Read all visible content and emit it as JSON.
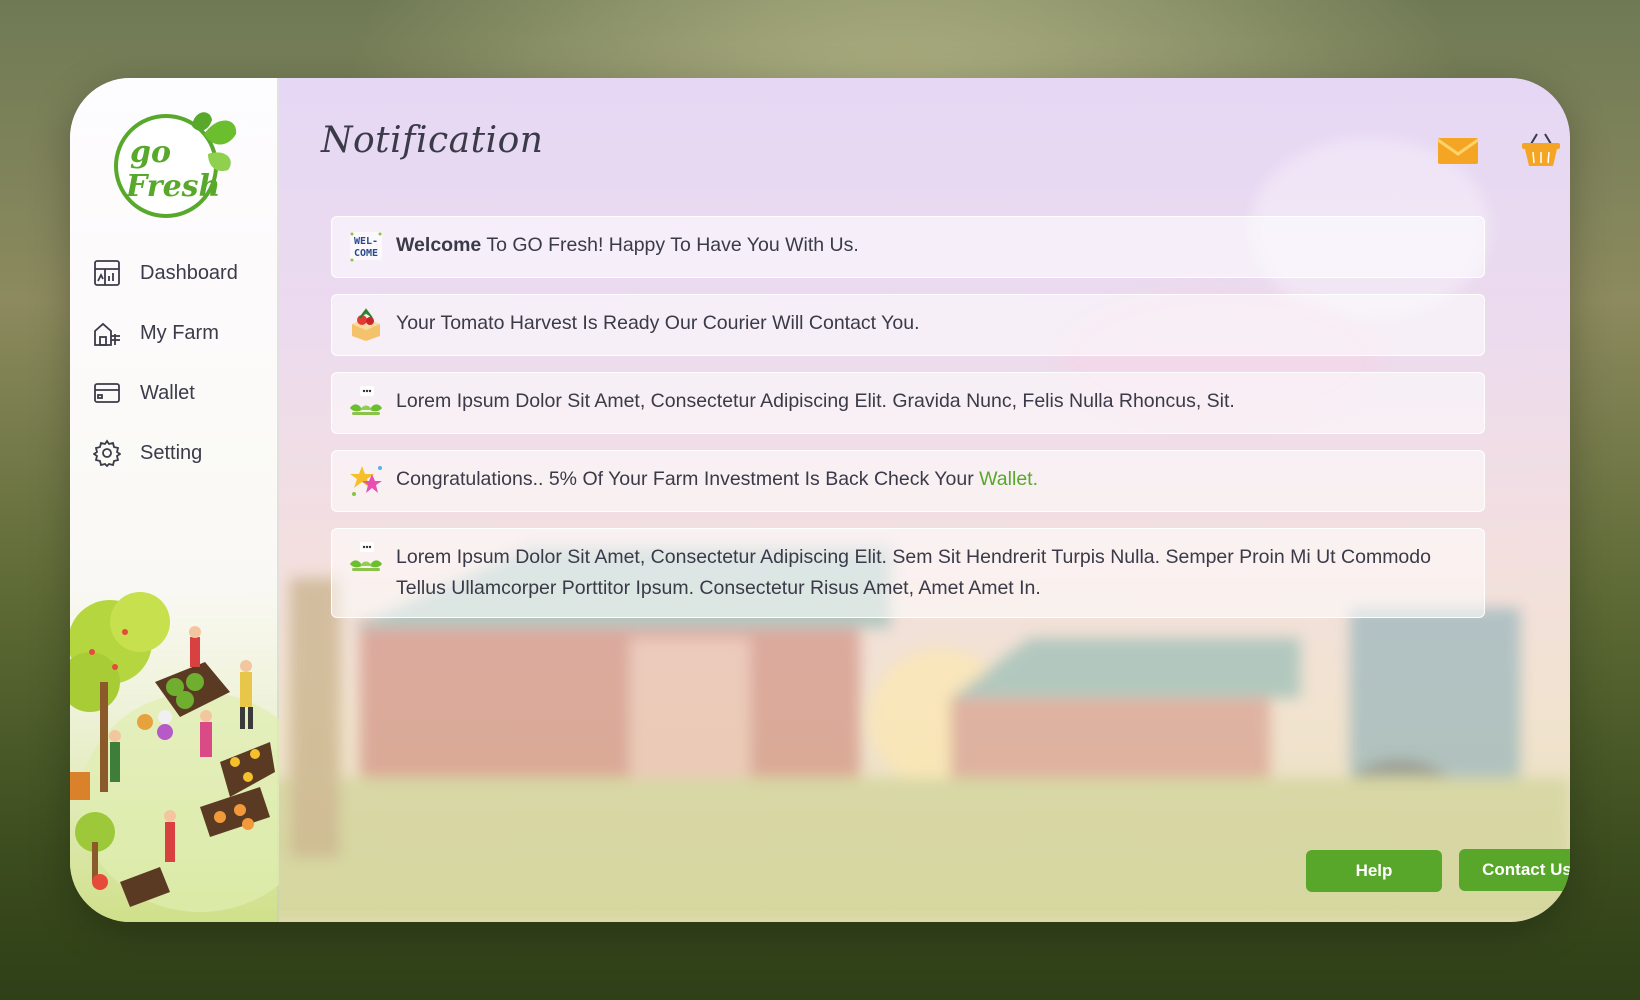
{
  "brand": {
    "logo_top": "go",
    "logo_bottom": "Fresh"
  },
  "sidebar": {
    "items": [
      {
        "label": "Dashboard",
        "icon": "dashboard-icon"
      },
      {
        "label": "My Farm",
        "icon": "farm-icon"
      },
      {
        "label": "Wallet",
        "icon": "wallet-icon"
      },
      {
        "label": "Setting",
        "icon": "gear-icon"
      }
    ]
  },
  "header": {
    "title": "Notification",
    "icons": [
      "mail-icon",
      "basket-icon"
    ]
  },
  "notifications": [
    {
      "icon": "welcome-icon",
      "badge": "WEL-\nCOME",
      "bold": "Welcome",
      "text": " To GO Fresh! Happy To Have You With Us."
    },
    {
      "icon": "harvest-box-icon",
      "text": "Your Tomato Harvest Is Ready Our Courier Will Contact You."
    },
    {
      "icon": "sprout-icon",
      "text": "Lorem Ipsum Dolor Sit Amet, Consectetur Adipiscing Elit. Gravida Nunc, Felis Nulla Rhoncus, Sit."
    },
    {
      "icon": "stars-icon",
      "text": "Congratulations.. 5% Of Your Farm Investment Is Back Check Your ",
      "link": "Wallet."
    },
    {
      "icon": "sprout-icon",
      "text": "Lorem Ipsum Dolor Sit Amet, Consectetur Adipiscing Elit. Sem Sit Hendrerit Turpis Nulla. Semper Proin Mi Ut Commodo Tellus Ullamcorper Porttitor Ipsum. Consectetur Risus Amet, Amet Amet In."
    }
  ],
  "footer": {
    "help_label": "Help",
    "contact_label": "Contact Us"
  },
  "colors": {
    "accent": "#58a72a",
    "icon_orange": "#f5a524",
    "text": "#3a3a48"
  }
}
